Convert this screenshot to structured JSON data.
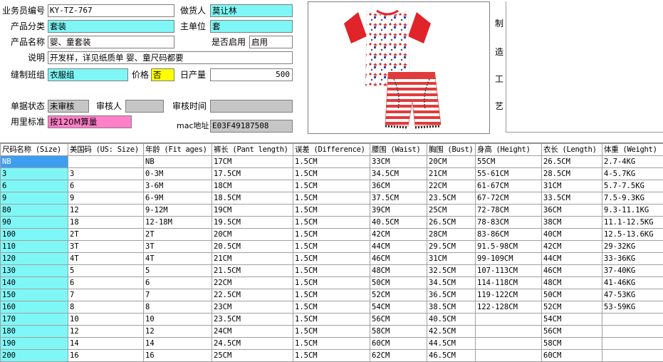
{
  "form": {
    "business_no": {
      "label": "业务员编号",
      "value": "KY-TZ-767"
    },
    "maker": {
      "label": "做货人",
      "value": "莫让林"
    },
    "category": {
      "label": "产品分类",
      "value": "套装"
    },
    "main_unit": {
      "label": "主单位",
      "value": "套"
    },
    "product_name": {
      "label": "产品名称",
      "value": "婴、童套装"
    },
    "enabled": {
      "label": "是否启用",
      "value": "启用"
    },
    "description": {
      "label": "说明",
      "value": "开发样，详见纸质单  婴、童尺码都要"
    },
    "sewing_group": {
      "label": "缝制班组",
      "value": "衣服组"
    },
    "price": {
      "label": "价格",
      "value": "否"
    },
    "daily_output": {
      "label": "日产量",
      "value": "500"
    },
    "doc_status": {
      "label": "单据状态",
      "value": "未审核"
    },
    "reviewer": {
      "label": "审核人",
      "value": ""
    },
    "review_time": {
      "label": "审核时间",
      "value": "  -  -        :"
    },
    "fabric_std": {
      "label": "用里标准",
      "value": "按120M算量"
    },
    "mac": {
      "label": "mac地址",
      "value": "E03F49187508"
    }
  },
  "craft": {
    "chars": [
      "制",
      "造",
      "工",
      "艺"
    ]
  },
  "colors": {
    "cyan": "#7ff7f7",
    "selected": "#3d9df0",
    "pink": "#ff7fc8",
    "yellow": "#ffff00"
  },
  "table": {
    "headers": [
      "尺码名称 (Size)",
      "美国码 (US: Size)",
      "年龄 (Fit ages)",
      "裤长 (Pant length)",
      "误差 (Difference)",
      "腰围 (Waist)",
      "胸围 (Bust)",
      "身高 (Height)",
      "衣长 (Length)",
      "体重 (Weight)"
    ],
    "rows": [
      [
        "NB",
        "",
        "NB",
        "17CM",
        "1.5CM",
        "33CM",
        "20CM",
        "55CM",
        "26.5CM",
        "2.7-4KG"
      ],
      [
        "3",
        "3",
        "0-3M",
        "17.5CM",
        "1.5CM",
        "34.5CM",
        "21CM",
        "55-61CM",
        "28.5CM",
        "4-5.7KG"
      ],
      [
        "6",
        "6",
        "3-6M",
        "18CM",
        "1.5CM",
        "36CM",
        "22CM",
        "61-67CM",
        "31CM",
        "5.7-7.5KG"
      ],
      [
        "9",
        "9",
        "6-9M",
        "18.5CM",
        "1.5CM",
        "37.5CM",
        "23.5CM",
        "67-72CM",
        "33.5CM",
        "7.5-9.3KG"
      ],
      [
        "80",
        "12",
        "9-12M",
        "19CM",
        "1.5CM",
        "39CM",
        "25CM",
        "72-78CM",
        "36CM",
        "9.3-11.1KG"
      ],
      [
        "90",
        "18",
        "12-18M",
        "19.5CM",
        "1.5CM",
        "40.5CM",
        "26.5CM",
        "78-83CM",
        "38CM",
        "11.1-12.5KG"
      ],
      [
        "100",
        "2T",
        "2T",
        "20CM",
        "1.5CM",
        "42CM",
        "28CM",
        "83-86CM",
        "40CM",
        "12.5-13.6KG"
      ],
      [
        "110",
        "3T",
        "3T",
        "20.5CM",
        "1.5CM",
        "44CM",
        "29.5CM",
        "91.5-98CM",
        "42CM",
        "29-32KG"
      ],
      [
        "120",
        "4T",
        "4T",
        "21CM",
        "1.5CM",
        "46CM",
        "31CM",
        "99-109CM",
        "44CM",
        "33-36KG"
      ],
      [
        "130",
        "5",
        "5",
        "21.5CM",
        "1.5CM",
        "48CM",
        "32.5CM",
        "107-113CM",
        "46CM",
        "37-40KG"
      ],
      [
        "140",
        "6",
        "6",
        "22CM",
        "1.5CM",
        "50CM",
        "34.5CM",
        "114-118CM",
        "48CM",
        "41-46KG"
      ],
      [
        "150",
        "7",
        "7",
        "22.5CM",
        "1.5CM",
        "52CM",
        "36.5CM",
        "119-122CM",
        "50CM",
        "47-53KG"
      ],
      [
        "160",
        "8",
        "8",
        "23CM",
        "1.5CM",
        "54CM",
        "38.5CM",
        "122-128CM",
        "52CM",
        "53-59KG"
      ],
      [
        "170",
        "10",
        "10",
        "23.5CM",
        "1.5CM",
        "56CM",
        "40.5CM",
        "",
        "54CM",
        ""
      ],
      [
        "180",
        "12",
        "12",
        "24CM",
        "1.5CM",
        "58CM",
        "42.5CM",
        "",
        "56CM",
        ""
      ],
      [
        "190",
        "14",
        "14",
        "24.5CM",
        "1.5CM",
        "60CM",
        "44.5CM",
        "",
        "58CM",
        ""
      ],
      [
        "200",
        "16",
        "16",
        "25CM",
        "1.5CM",
        "62CM",
        "46.5CM",
        "",
        "60CM",
        ""
      ]
    ]
  }
}
